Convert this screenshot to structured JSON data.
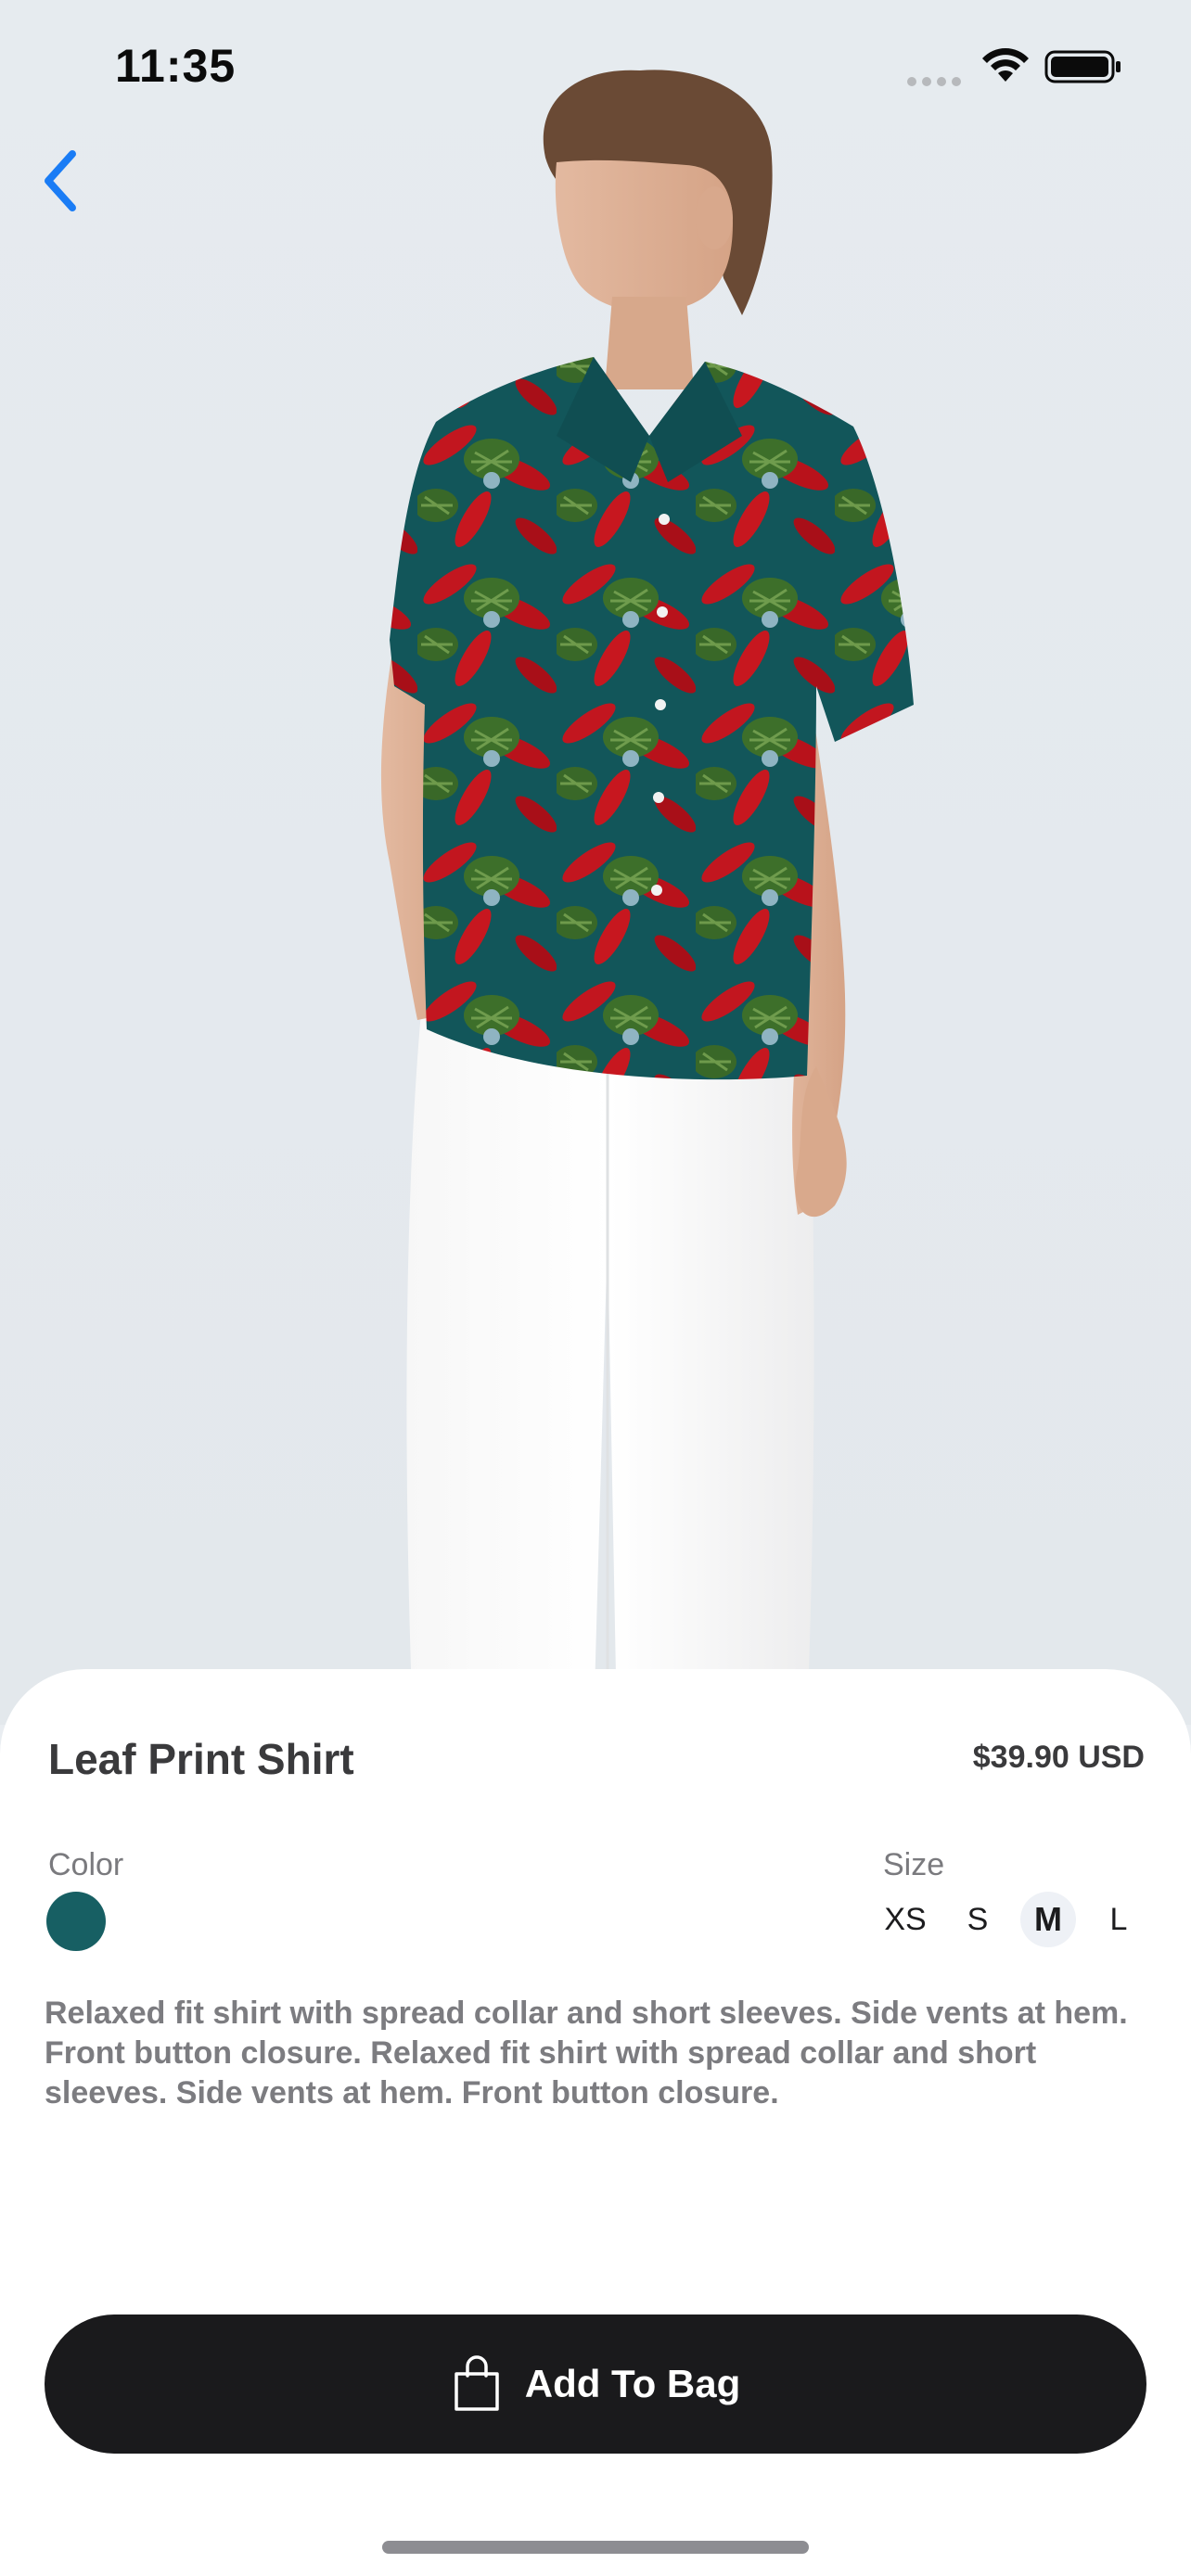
{
  "status_bar": {
    "time": "11:35",
    "signal_icon": "signal-dots-icon",
    "wifi_icon": "wifi-icon",
    "battery_icon": "battery-icon"
  },
  "nav": {
    "back_icon": "chevron-left-icon",
    "accent": "#1a7cf5"
  },
  "product": {
    "name": "Leaf Print Shirt",
    "price": "$39.90 USD",
    "color_label": "Color",
    "color_swatch": "#175f63",
    "size_label": "Size",
    "sizes": [
      "XS",
      "S",
      "M",
      "L"
    ],
    "selected_size": "M",
    "description": "Relaxed fit shirt with spread collar and short sleeves. Side vents at hem. Front button closure. Relaxed fit shirt with spread collar and short sleeves. Side vents at hem. Front button closure."
  },
  "actions": {
    "add_to_bag_label": "Add To Bag",
    "bag_icon": "shopping-bag-icon"
  }
}
